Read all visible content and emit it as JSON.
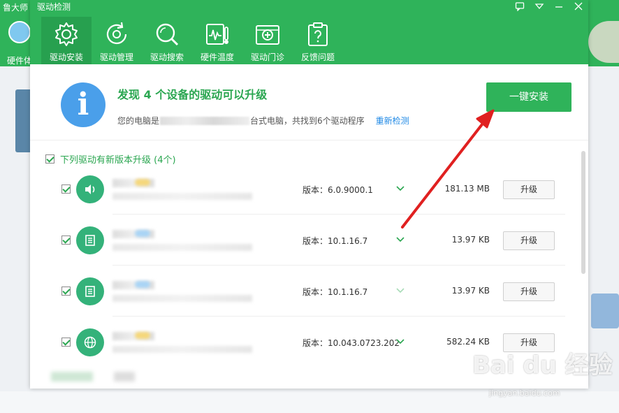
{
  "background": {
    "app_title": "鲁大师",
    "hw_label": "硬件体"
  },
  "dialog": {
    "title": "驱动检测",
    "window_buttons": [
      "message-icon",
      "dropdown-icon",
      "minimize-icon",
      "close-icon"
    ],
    "tabs": [
      {
        "label": "驱动安装",
        "icon": "gear-icon",
        "active": true
      },
      {
        "label": "驱动管理",
        "icon": "refresh-icon",
        "active": false
      },
      {
        "label": "驱动搜索",
        "icon": "search-icon",
        "active": false
      },
      {
        "label": "硬件温度",
        "icon": "thermometer-icon",
        "active": false
      },
      {
        "label": "驱动门诊",
        "icon": "clinic-icon",
        "active": false
      },
      {
        "label": "反馈问题",
        "icon": "clipboard-icon",
        "active": false
      }
    ]
  },
  "info": {
    "title": "发现 4 个设备的驱动可以升级",
    "sub_prefix": "您的电脑是",
    "sub_suffix": "台式电脑，共找到6个驱动程序",
    "recheck": "重新检测",
    "install_all": "一键安装"
  },
  "section": {
    "label": "下列驱动有新版本升级 (4个)"
  },
  "drivers": [
    {
      "icon": "speaker-icon",
      "version": "版本：6.0.9000.1",
      "size": "181.13 MB",
      "upgrade": "升级",
      "badge": "#f5d77a"
    },
    {
      "icon": "chip-icon",
      "version": "版本：10.1.16.7",
      "size": "13.97 KB",
      "upgrade": "升级",
      "badge": "#a9d4f5"
    },
    {
      "icon": "chip-icon",
      "version": "版本：10.1.16.7",
      "size": "13.97 KB",
      "upgrade": "升级",
      "badge": "#a9d4f5"
    },
    {
      "icon": "globe-icon",
      "version": "版本：10.043.0723.202",
      "size": "582.24 KB",
      "upgrade": "升级",
      "badge": "#f5d77a"
    }
  ],
  "colors": {
    "accent": "#2fb35a",
    "link": "#1e88e5",
    "annotation": "#e02020"
  },
  "watermark": {
    "text": "Bai du 经验",
    "url": "jingyan.baidu.com"
  }
}
